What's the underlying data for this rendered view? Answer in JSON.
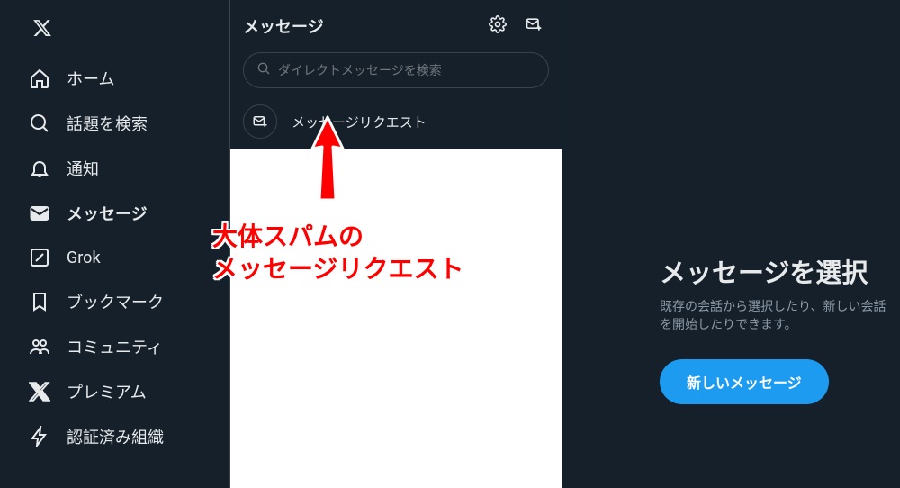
{
  "nav": {
    "items": [
      {
        "key": "home",
        "label": "ホーム"
      },
      {
        "key": "explore",
        "label": "話題を検索"
      },
      {
        "key": "notifications",
        "label": "通知"
      },
      {
        "key": "messages",
        "label": "メッセージ"
      },
      {
        "key": "grok",
        "label": "Grok"
      },
      {
        "key": "bookmarks",
        "label": "ブックマーク"
      },
      {
        "key": "communities",
        "label": "コミュニティ"
      },
      {
        "key": "premium",
        "label": "プレミアム"
      },
      {
        "key": "verified",
        "label": "認証済み組織"
      }
    ],
    "selected": "messages"
  },
  "messages": {
    "title": "メッセージ",
    "search_placeholder": "ダイレクトメッセージを検索",
    "requests_label": "メッセージリクエスト"
  },
  "annotation": {
    "line1": "大体スパムの",
    "line2": "メッセージリクエスト"
  },
  "right": {
    "title": "メッセージを選択",
    "subtitle": "既存の会話から選択したり、新しい会話を開始したりできます。",
    "button": "新しいメッセージ"
  },
  "colors": {
    "accent": "#1d9bf0",
    "bg": "#15202b"
  }
}
